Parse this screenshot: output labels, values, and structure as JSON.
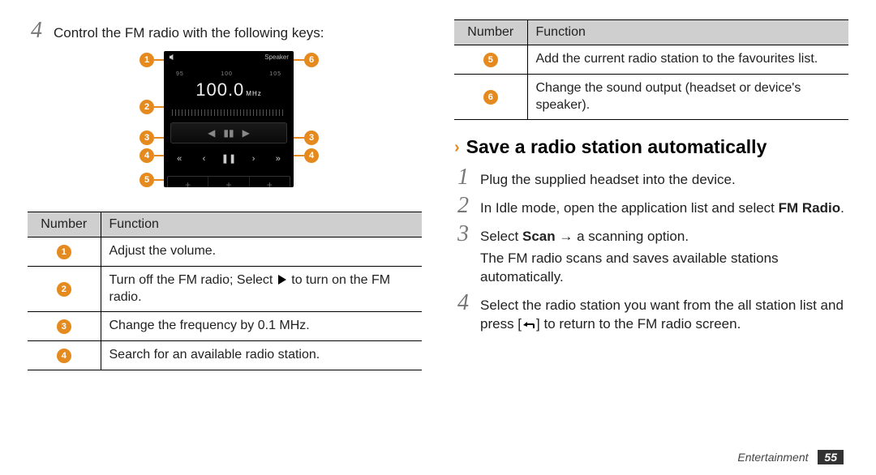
{
  "left": {
    "step4": "Control the FM radio with the following keys:",
    "radio": {
      "freq": "100.0",
      "unit": "MHz",
      "scale_left": "95",
      "scale_mid": "100",
      "scale_right": "105",
      "speaker_label": "Speaker"
    },
    "callouts": {
      "c1": "1",
      "c2": "2",
      "c3": "3",
      "c4": "4",
      "c5": "5",
      "c6": "6"
    },
    "table": {
      "head_num": "Number",
      "head_fn": "Function",
      "r1": "Adjust the volume.",
      "r2a": "Turn off the FM radio; Select ",
      "r2b": " to turn on the FM radio.",
      "r3": "Change the frequency by 0.1 MHz.",
      "r4": "Search for an available radio station."
    }
  },
  "right": {
    "table": {
      "head_num": "Number",
      "head_fn": "Function",
      "r5": "Add the current radio station to the favourites list.",
      "r6": "Change the sound output (headset or device's speaker)."
    },
    "section_title": "Save a radio station automatically",
    "step1": "Plug the supplied headset into the device.",
    "step2a": "In Idle mode, open the application list and select ",
    "step2b_bold": "FM Radio",
    "step2c": ".",
    "step3a": "Select ",
    "step3b_bold": "Scan",
    "step3c": " → a scanning option.",
    "step3_sub": "The FM radio scans and saves available stations automatically.",
    "step4a": "Select the radio station you want from the all station list and press [",
    "step4b": "] to return to the FM radio screen."
  },
  "footer": {
    "section": "Entertainment",
    "page": "55"
  }
}
